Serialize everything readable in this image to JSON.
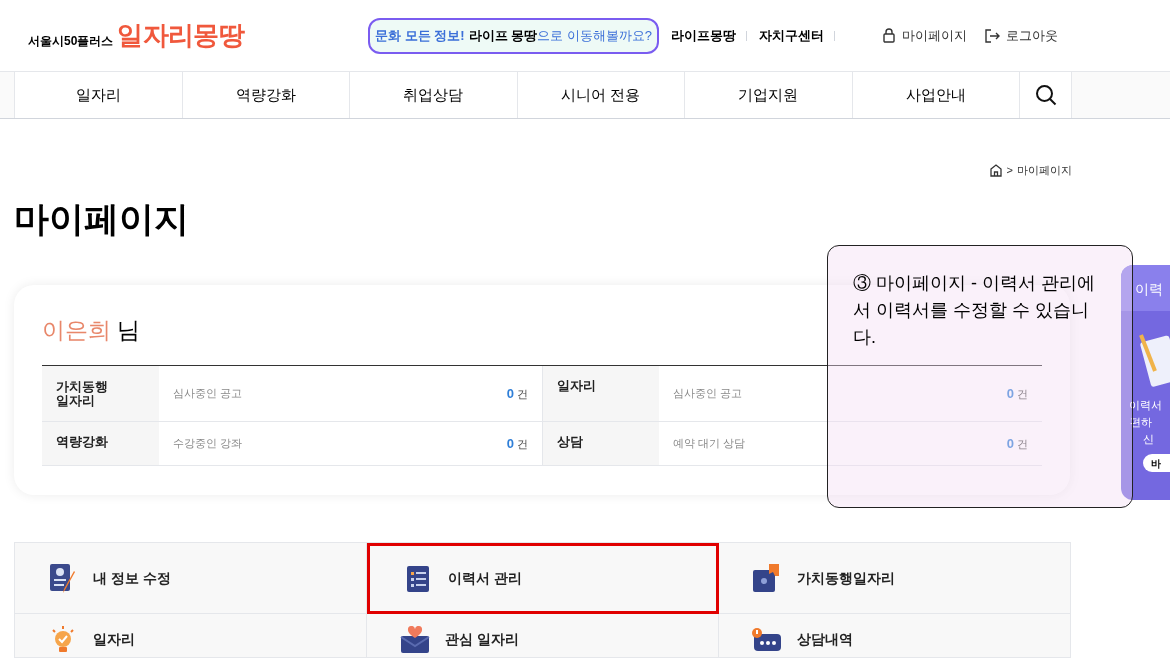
{
  "header": {
    "brand_small": "서울시50플러스",
    "brand_large": "일자리몽땅",
    "promo": {
      "highlight": "문화 모든 정보!",
      "emphasis": "라이프 몽땅",
      "rest": "으로 이동해볼까요?"
    },
    "links": [
      "라이프몽땅",
      "자치구센터"
    ],
    "user_links": [
      {
        "kind": "lock",
        "label": "마이페이지"
      },
      {
        "kind": "logout",
        "label": "로그아웃"
      }
    ]
  },
  "nav": {
    "items": [
      "일자리",
      "역량강화",
      "취업상담",
      "시니어 전용",
      "기업지원",
      "사업안내"
    ]
  },
  "breadcrumb": {
    "separator": ">",
    "current": "마이페이지"
  },
  "page_title": "마이페이지",
  "summary": {
    "name": "이은희",
    "suffix": "님",
    "rows": [
      [
        {
          "label": "가치동행\n일자리",
          "desc": "심사중인 공고",
          "count": "0",
          "unit": "건"
        },
        {
          "label": "일자리",
          "desc": "심사중인 공고",
          "count": "0",
          "unit": "건"
        }
      ],
      [
        {
          "label": "역량강화",
          "desc": "수강중인 강좌",
          "count": "0",
          "unit": "건"
        },
        {
          "label": "상담",
          "desc": "예약 대기 상담",
          "count": "0",
          "unit": "건"
        }
      ]
    ]
  },
  "menu": [
    {
      "kind": "profile",
      "label": "내 정보 수정",
      "highlighted": false
    },
    {
      "kind": "resume",
      "label": "이력서 관리",
      "highlighted": true
    },
    {
      "kind": "puzzle",
      "label": "가치동행일자리",
      "highlighted": false
    },
    {
      "kind": "bulb",
      "label": "일자리",
      "highlighted": false
    },
    {
      "kind": "heart",
      "label": "관심 일자리",
      "highlighted": false
    },
    {
      "kind": "chat",
      "label": "상담내역",
      "highlighted": false
    }
  ],
  "side_banner": {
    "title": "이력",
    "lines": [
      "이력서",
      "편하",
      "신"
    ],
    "button": "바"
  },
  "callout": {
    "text": "③ 마이페이지 - 이력서 관리에서 이력서를 수정할 수 있습니다."
  }
}
